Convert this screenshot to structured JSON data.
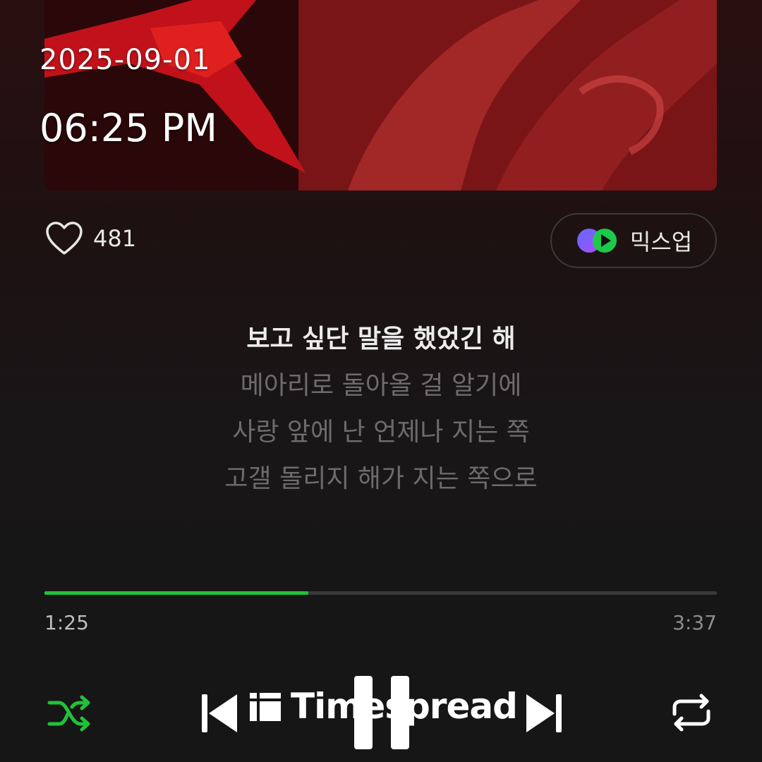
{
  "status": {
    "date": "2025-09-01",
    "time": "06:25 PM"
  },
  "track": {
    "like_count": "481",
    "mixup_label": "믹스업"
  },
  "lyrics": [
    "보고 싶단 말을 했었긴 해",
    "메아리로 돌아올 걸 알기에",
    "사랑 앞에 난 언제나 지는 쪽",
    "고갤 돌리지 해가 지는 쪽으로"
  ],
  "playback": {
    "current_time": "1:25",
    "total_time": "3:37",
    "progress": 0.392
  },
  "watermark": {
    "text": "Timespread"
  },
  "colors": {
    "accent_green": "#21c23a",
    "album_red": "#8e1a1a"
  },
  "icons": {
    "like": "heart-outline-icon",
    "mixup": "mixup-logo-icon",
    "shuffle": "shuffle-icon",
    "previous": "skip-previous-icon",
    "pause": "pause-icon",
    "next": "skip-next-icon",
    "repeat": "repeat-icon"
  }
}
